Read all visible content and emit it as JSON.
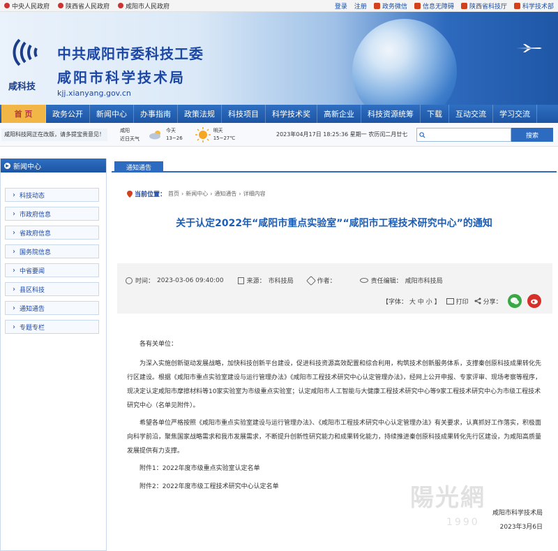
{
  "topbar": {
    "left_links": [
      "中央人民政府",
      "陕西省人民政府",
      "咸阳市人民政府"
    ],
    "login": "登录",
    "register": "注册",
    "right_links": [
      "政务微信",
      "信息无障碍",
      "陕西省科技厅",
      "科学技术部"
    ]
  },
  "banner": {
    "logo_text": "咸科技",
    "title_line1": "中共咸阳市委科技工委",
    "title_line2": "咸阳市科学技术局",
    "domain": "kjj.xianyang.gov.cn"
  },
  "nav": {
    "items": [
      "首 页",
      "政务公开",
      "新闻中心",
      "办事指南",
      "政策法规",
      "科技项目",
      "科学技术奖",
      "高新企业",
      "科技资源统筹",
      "下载",
      "互动交流",
      "学习交流"
    ]
  },
  "infobar": {
    "notice": "咸阳科技网正在改版，请多提宝贵意见！",
    "city": "咸阳",
    "city_sub": "近日天气",
    "today_label": "今天",
    "today_temp": "13~26",
    "tomorrow_label": "明天",
    "tomorrow_temp": "15~27℃",
    "datetime": "2023年04月17日 18:25:36 星期一 农历闰二月廿七",
    "search_button": "搜索",
    "search_placeholder": ""
  },
  "sidebar": {
    "heading": "新闻中心",
    "items": [
      "科技动态",
      "市政府信息",
      "省政府信息",
      "国务院信息",
      "中省要闻",
      "县区科技",
      "通知通告",
      "专题专栏"
    ]
  },
  "main": {
    "tab": "通知通告",
    "breadcrumb_lead": "当前位置：",
    "breadcrumb": [
      "首页",
      "新闻中心",
      "通知通告",
      "详细内容"
    ],
    "title": "关于认定2022年“咸阳市重点实验室”“咸阳市工程技术研究中心”的通知",
    "meta": {
      "time_label": "时间：",
      "time": "2023-03-06 09:40:00",
      "source_label": "来源：",
      "source": "市科技局",
      "author_label": "作者：",
      "author": "",
      "editor_label": "责任编辑：",
      "editor": "咸阳市科技局",
      "font_label": "【字体：",
      "font_sizes": [
        "大",
        "中",
        "小"
      ],
      "font_end": "】",
      "print": "打印",
      "share": "分享："
    },
    "body": {
      "salutation": "各有关单位：",
      "paragraphs": [
        "为深入实施创新驱动发展战略，加快科技创新平台建设，促进科技资源高效配置和综合利用，构筑技术创新服务体系，支撑秦创原科技成果转化先行区建设。根据《咸阳市重点实验室建设与运行管理办法》《咸阳市工程技术研究中心认定管理办法》，经网上公开申报、专家评审、现场考察等程序，现决定认定咸阳市摩擦材料等10家实验室为市级重点实验室；认定咸阳市人工智能与大健康工程技术研究中心等9家工程技术研究中心为市级工程技术研究中心（名单见附件）。",
        "希望各单位严格按照《咸阳市重点实验室建设与运行管理办法》、《咸阳市工程技术研究中心认定管理办法》有关要求，认真抓好工作落实，积极面向科学前沿，聚焦国家战略需求和我市发展需求，不断提升创新性研究能力和成果转化能力，持续推进秦创原科技成果转化先行区建设，为咸阳高质量发展提供有力支撑。"
      ],
      "attachments": [
        "附件1：2022年度市级重点实验室认定名单",
        "附件2：2022年度市级工程技术研究中心认定名单"
      ],
      "signature_org": "咸阳市科学技术局",
      "signature_date": "2023年3月6日"
    }
  },
  "watermark": {
    "text": "陽光網",
    "sub": "1990"
  }
}
